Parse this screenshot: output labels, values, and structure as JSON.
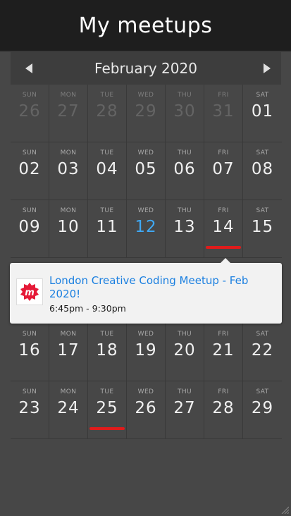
{
  "app": {
    "title": "My meetups"
  },
  "nav": {
    "month_label": "February 2020"
  },
  "colors": {
    "accent_blue": "#3fa9f5",
    "marker_red": "#e01b1b",
    "link_blue": "#1a7fe0"
  },
  "weeks_top": [
    [
      {
        "dow": "SUN",
        "day": "26",
        "muted": true
      },
      {
        "dow": "MON",
        "day": "27",
        "muted": true
      },
      {
        "dow": "TUE",
        "day": "28",
        "muted": true
      },
      {
        "dow": "WED",
        "day": "29",
        "muted": true
      },
      {
        "dow": "THU",
        "day": "30",
        "muted": true
      },
      {
        "dow": "FRI",
        "day": "31",
        "muted": true
      },
      {
        "dow": "SAT",
        "day": "01"
      }
    ],
    [
      {
        "dow": "SUN",
        "day": "02"
      },
      {
        "dow": "MON",
        "day": "03"
      },
      {
        "dow": "TUE",
        "day": "04"
      },
      {
        "dow": "WED",
        "day": "05"
      },
      {
        "dow": "THU",
        "day": "06"
      },
      {
        "dow": "FRI",
        "day": "07"
      },
      {
        "dow": "SAT",
        "day": "08"
      }
    ],
    [
      {
        "dow": "SUN",
        "day": "09"
      },
      {
        "dow": "MON",
        "day": "10"
      },
      {
        "dow": "TUE",
        "day": "11"
      },
      {
        "dow": "WED",
        "day": "12",
        "today": true
      },
      {
        "dow": "THU",
        "day": "13"
      },
      {
        "dow": "FRI",
        "day": "14",
        "event": true
      },
      {
        "dow": "SAT",
        "day": "15"
      }
    ]
  ],
  "weeks_bottom": [
    [
      {
        "dow": "SUN",
        "day": "16"
      },
      {
        "dow": "MON",
        "day": "17"
      },
      {
        "dow": "TUE",
        "day": "18"
      },
      {
        "dow": "WED",
        "day": "19"
      },
      {
        "dow": "THU",
        "day": "20"
      },
      {
        "dow": "FRI",
        "day": "21"
      },
      {
        "dow": "SAT",
        "day": "22"
      }
    ],
    [
      {
        "dow": "SUN",
        "day": "23"
      },
      {
        "dow": "MON",
        "day": "24"
      },
      {
        "dow": "TUE",
        "day": "25",
        "event": true
      },
      {
        "dow": "WED",
        "day": "26"
      },
      {
        "dow": "THU",
        "day": "27"
      },
      {
        "dow": "FRI",
        "day": "28"
      },
      {
        "dow": "SAT",
        "day": "29"
      }
    ]
  ],
  "popup": {
    "event_title": "London Creative Coding Meetup - Feb 2020!",
    "event_time": "6:45pm - 9:30pm",
    "logo_icon": "meetup-logo-icon"
  }
}
